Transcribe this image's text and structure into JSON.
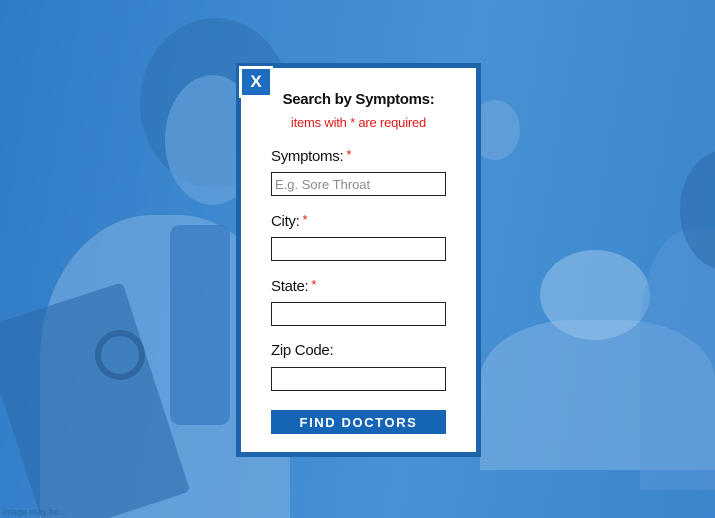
{
  "background": {
    "tint_color": "#3a86cc",
    "credit_text": "Image may be..."
  },
  "modal": {
    "border_color": "#1e64ab",
    "close_label": "X",
    "title": "Search by Symptoms:",
    "required_note": "items with * are required",
    "required_marker": "*",
    "accent_red": "#e01818",
    "fields": [
      {
        "label": "Symptoms:",
        "required": true,
        "value": "",
        "placeholder": "E.g. Sore Throat"
      },
      {
        "label": "City:",
        "required": true,
        "value": "",
        "placeholder": ""
      },
      {
        "label": "State:",
        "required": true,
        "value": "",
        "placeholder": ""
      },
      {
        "label": "Zip Code:",
        "required": false,
        "value": "",
        "placeholder": ""
      }
    ],
    "submit_label": "FIND DOCTORS",
    "submit_color": "#1465b6"
  }
}
